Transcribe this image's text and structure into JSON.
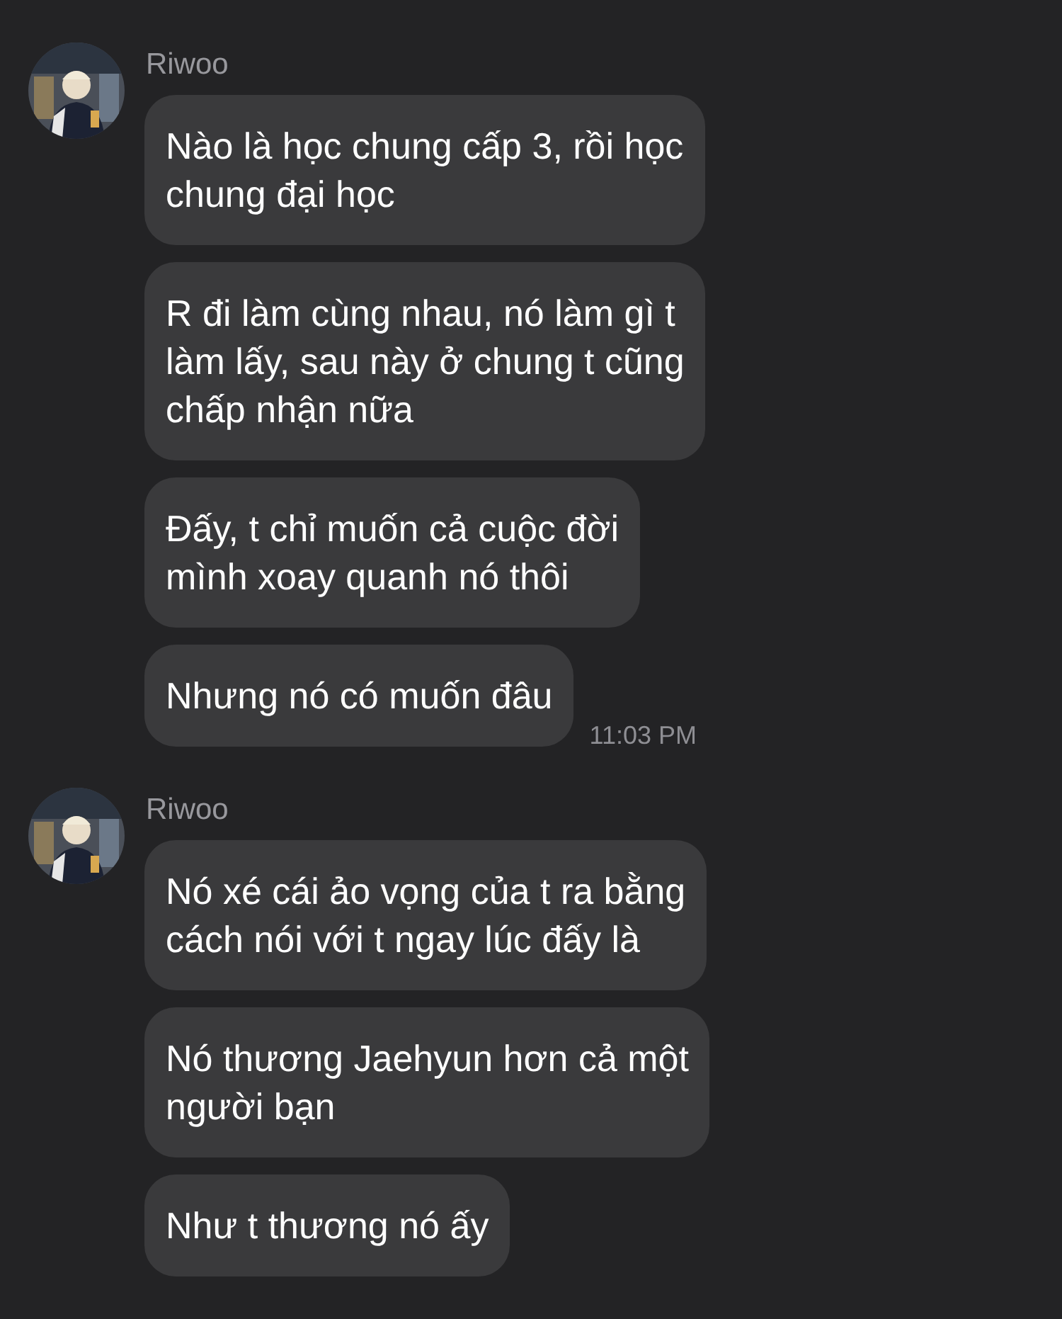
{
  "groups": [
    {
      "sender": "Riwoo",
      "avatar": {
        "kind": "picture"
      },
      "messages": [
        {
          "text": "Nào là học chung cấp 3, rồi học\nchung đại học"
        },
        {
          "text": "R đi làm cùng nhau, nó làm gì t\nlàm lấy, sau này ở chung t cũng\nchấp nhận nữa"
        },
        {
          "text": "Đấy, t chỉ muốn cả cuộc đời\nmình xoay quanh nó thôi"
        },
        {
          "text": "Nhưng nó có muốn đâu"
        }
      ],
      "time": "11:03 PM"
    },
    {
      "sender": "Riwoo",
      "avatar": {
        "kind": "picture"
      },
      "messages": [
        {
          "text": "Nó xé cái ảo vọng của t ra bằng\ncách nói với t ngay lúc đấy là"
        },
        {
          "text": "Nó thương Jaehyun hơn cả một\nngười bạn"
        },
        {
          "text": "Như t thương nó ấy"
        }
      ]
    }
  ]
}
